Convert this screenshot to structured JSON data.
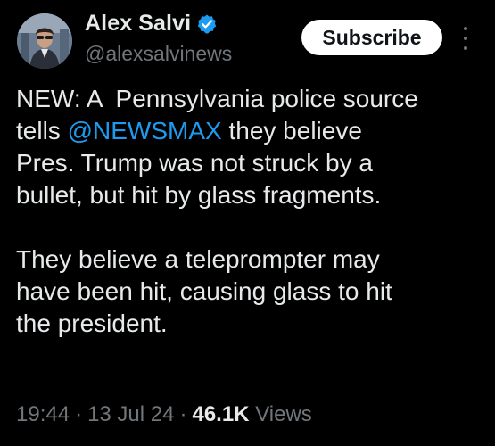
{
  "author": {
    "display_name": "Alex Salvi",
    "handle": "@alexsalvinews",
    "verified_icon": "verified-badge-icon",
    "avatar": "profile-avatar"
  },
  "actions": {
    "subscribe_label": "Subscribe",
    "more_icon": "more-options-icon"
  },
  "tweet": {
    "line1": "NEW: A  Pennsylvania police source",
    "line2_prefix": "tells ",
    "mention": "@NEWSMAX",
    "line2_suffix": " they believe",
    "line3": "Pres. Trump was not struck by a",
    "line4": "bullet, but hit by glass fragments.",
    "line5": "They believe a teleprompter may",
    "line6": "have been hit, causing glass to hit",
    "line7": "the president."
  },
  "meta": {
    "time": "19:44",
    "separator": "·",
    "date": "13 Jul 24",
    "views_count": "46.1K",
    "views_label": "Views"
  },
  "colors": {
    "background": "#000000",
    "text": "#e7e9ea",
    "secondary": "#71767b",
    "link": "#1d9bf0",
    "verified": "#1d9bf0"
  }
}
